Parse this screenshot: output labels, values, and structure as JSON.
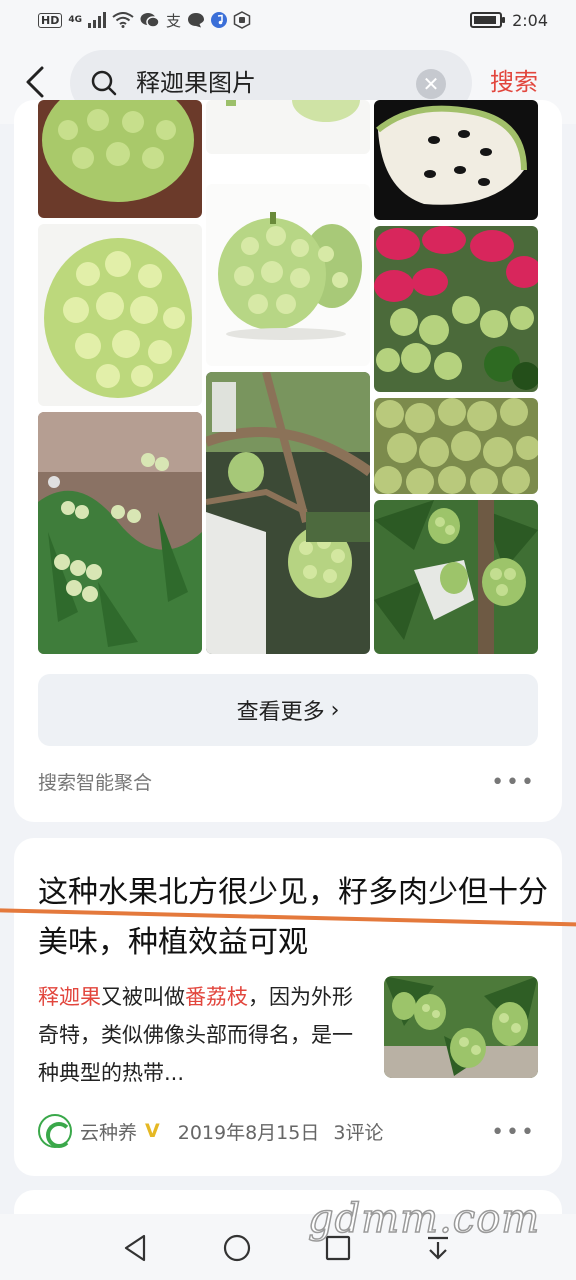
{
  "status_bar": {
    "hd": "HD",
    "network": "4G",
    "time": "2:04",
    "icons": [
      "signal-icon",
      "wifi-icon",
      "wechat-icon",
      "alipay-icon",
      "chat-icon",
      "music-icon",
      "hand-icon",
      "battery-icon"
    ]
  },
  "search": {
    "query": "释迦果图片",
    "submit_label": "搜索"
  },
  "images": {
    "more_label": "查看更多",
    "source_label": "搜索智能聚合"
  },
  "article": {
    "title": "这种水果北方很少见，籽多肉少但十分美味，种植效益可观",
    "snippet_parts": {
      "hl1": "释迦果",
      "t1": "又被叫做",
      "hl2": "番荔枝",
      "t2": "，因为外形奇特，类似佛像头部而得名，是一种典型的热带..."
    },
    "source": "云种养",
    "verified_mark": "V",
    "date": "2019年8月15日",
    "comments": "3评论"
  },
  "nav": {
    "icons": [
      "back-triangle-icon",
      "home-circle-icon",
      "recents-square-icon",
      "download-arrow-icon"
    ]
  },
  "watermark": "gdmm.com",
  "colors": {
    "accent": "#e2463d",
    "underline": "#e4793c",
    "verified": "#e5b824"
  }
}
